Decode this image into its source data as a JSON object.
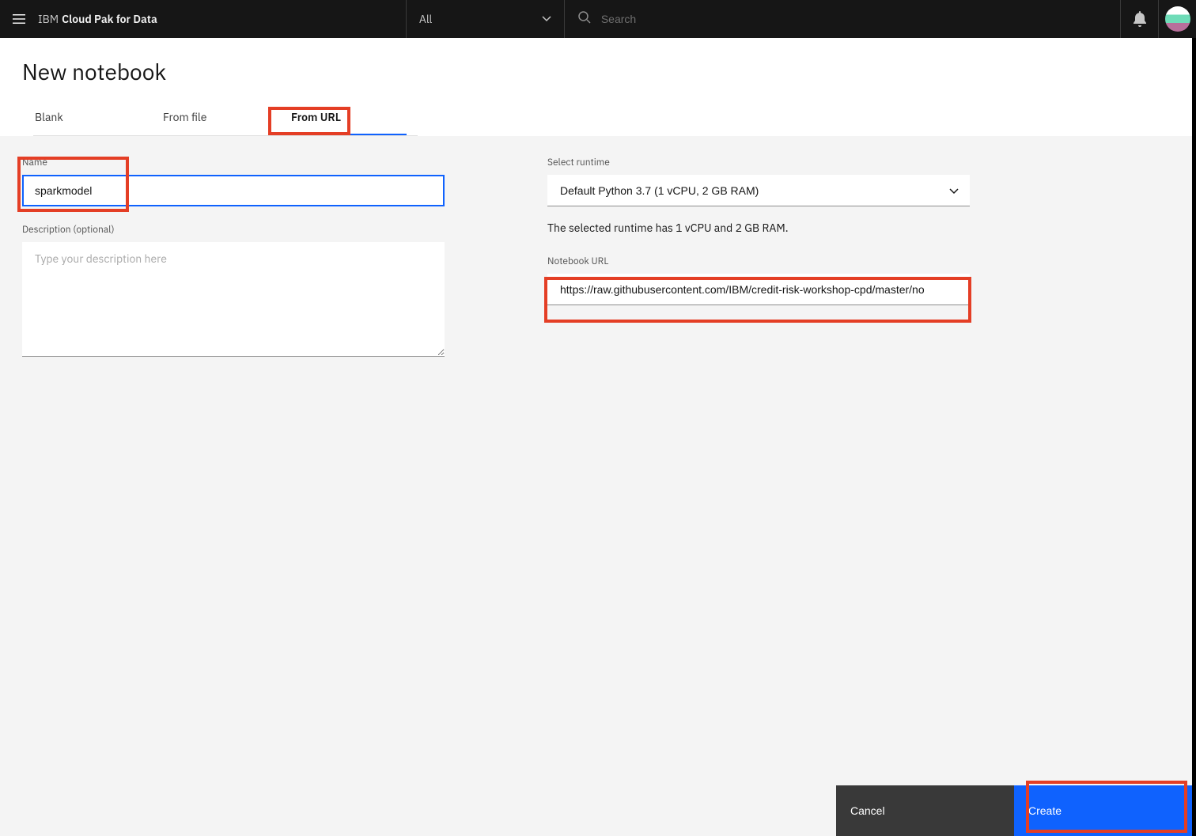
{
  "header": {
    "brand_prefix": "IBM",
    "brand_product": "Cloud Pak for Data",
    "filter_selected": "All",
    "search_placeholder": "Search"
  },
  "page": {
    "title": "New notebook"
  },
  "tabs": {
    "blank": "Blank",
    "from_file": "From file",
    "from_url": "From URL"
  },
  "form": {
    "name_label": "Name",
    "name_value": "sparkmodel",
    "description_label": "Description (optional)",
    "description_placeholder": "Type your description here",
    "description_value": "",
    "runtime_label": "Select runtime",
    "runtime_selected": "Default Python 3.7 (1 vCPU, 2 GB RAM)",
    "runtime_description": "The selected runtime has 1 vCPU and 2 GB RAM.",
    "notebook_url_label": "Notebook URL",
    "notebook_url_value": "https://raw.githubusercontent.com/IBM/credit-risk-workshop-cpd/master/no"
  },
  "footer": {
    "cancel": "Cancel",
    "create": "Create"
  }
}
